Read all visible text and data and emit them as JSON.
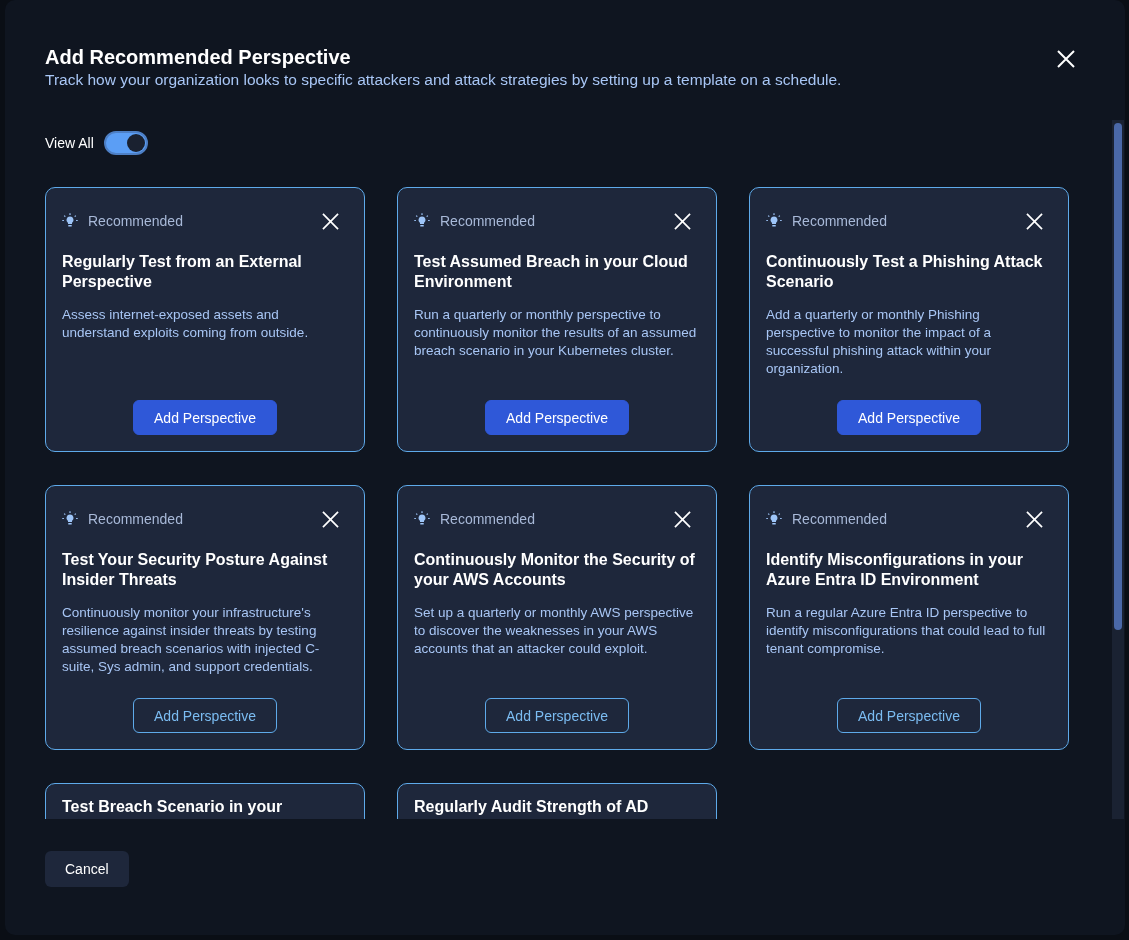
{
  "dialog": {
    "title": "Add Recommended Perspective",
    "subtitle": "Track how your organization looks to specific attackers and attack strategies by setting up a template on a schedule."
  },
  "view_all": {
    "label": "View All",
    "on": true
  },
  "cards": [
    {
      "tag": "Recommended",
      "title": "Regularly Test from an External Perspective",
      "description": "Assess internet-exposed assets and understand exploits coming from outside.",
      "button": {
        "label": "Add Perspective",
        "kind": "primary"
      }
    },
    {
      "tag": "Recommended",
      "title": "Test Assumed Breach in your Cloud Environment",
      "description": "Run a quarterly or monthly perspective to continuously monitor the results of an assumed breach scenario in your Kubernetes cluster.",
      "button": {
        "label": "Add Perspective",
        "kind": "primary"
      }
    },
    {
      "tag": "Recommended",
      "title": "Continuously Test a Phishing Attack Scenario",
      "description": "Add a quarterly or monthly Phishing perspective to monitor the impact of a successful phishing attack within your organization.",
      "button": {
        "label": "Add Perspective",
        "kind": "primary"
      }
    },
    {
      "tag": "Recommended",
      "title": "Test Your Security Posture Against Insider Threats",
      "description": "Continuously monitor your infrastructure's resilience against insider threats by testing assumed breach scenarios with injected C-suite, Sys admin, and support credentials.",
      "button": {
        "label": "Add Perspective",
        "kind": "outline"
      }
    },
    {
      "tag": "Recommended",
      "title": "Continuously Monitor the Security of your AWS Accounts",
      "description": "Set up a quarterly or monthly AWS perspective to discover the weaknesses in your AWS accounts that an attacker could exploit.",
      "button": {
        "label": "Add Perspective",
        "kind": "outline"
      }
    },
    {
      "tag": "Recommended",
      "title": "Identify Misconfigurations in your Azure Entra ID Environment",
      "description": "Run a regular Azure Entra ID perspective to identify misconfigurations that could lead to full tenant compromise.",
      "button": {
        "label": "Add Perspective",
        "kind": "outline"
      }
    },
    {
      "title": "Test Breach Scenario in your"
    },
    {
      "title": "Regularly Audit Strength of AD"
    }
  ],
  "footer": {
    "cancel": "Cancel"
  }
}
